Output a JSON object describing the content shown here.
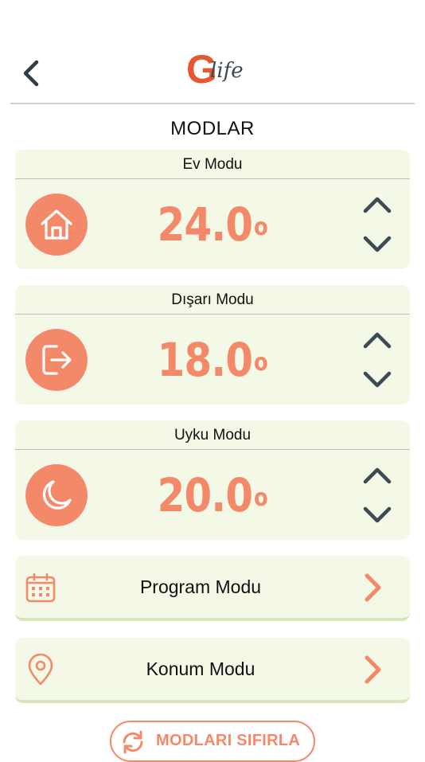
{
  "header": {
    "logo_g": "G",
    "logo_life": "life",
    "back_icon": "chevron-left-icon"
  },
  "page": {
    "title": "MODLAR"
  },
  "modes": [
    {
      "title": "Ev Modu",
      "temperature": "24.0",
      "unit": "o",
      "icon": "home-icon"
    },
    {
      "title": "Dışarı Modu",
      "temperature": "18.0",
      "unit": "o",
      "icon": "logout-icon"
    },
    {
      "title": "Uyku Modu",
      "temperature": "20.0",
      "unit": "o",
      "icon": "moon-icon"
    }
  ],
  "nav": [
    {
      "label": "Program Modu",
      "icon": "calendar-icon"
    },
    {
      "label": "Konum Modu",
      "icon": "location-pin-icon"
    }
  ],
  "reset": {
    "label": "MODLARI SIFIRLA",
    "icon": "refresh-icon"
  },
  "colors": {
    "accent": "#f4896a",
    "logo_red": "#e8552e",
    "card_bg": "#f3f9e6",
    "arrow": "#3c4a52"
  }
}
